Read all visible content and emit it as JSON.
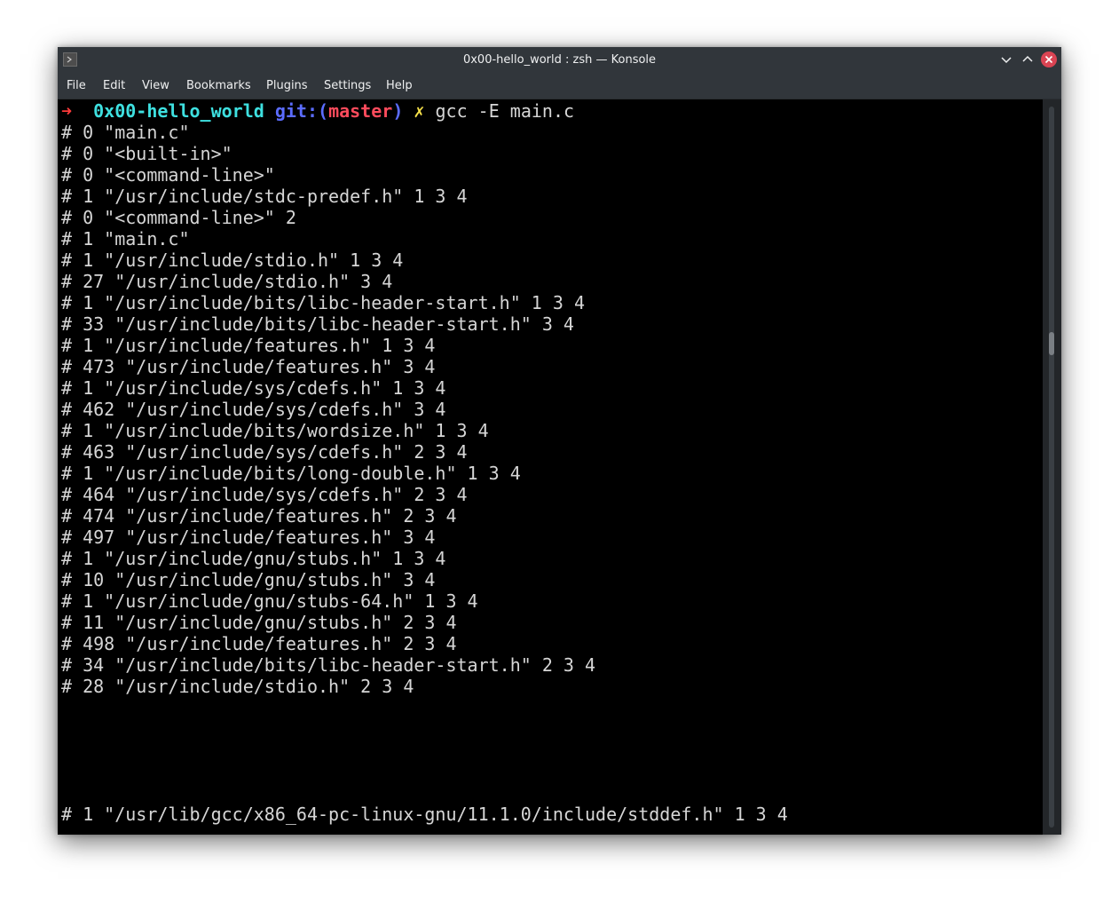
{
  "window": {
    "title": "0x00-hello_world : zsh — Konsole"
  },
  "menubar": {
    "items": [
      {
        "label": "File"
      },
      {
        "label": "Edit"
      },
      {
        "label": "View"
      },
      {
        "label": "Bookmarks"
      },
      {
        "label": "Plugins"
      },
      {
        "label": "Settings"
      },
      {
        "label": "Help"
      }
    ]
  },
  "prompt": {
    "arrow": "➜",
    "directory": "0x00-hello_world",
    "git_label": "git:(",
    "branch": "master",
    "git_close": ")",
    "dirty_mark": "✗",
    "command": "gcc -E main.c"
  },
  "output_lines": [
    "# 0 \"main.c\"",
    "# 0 \"<built-in>\"",
    "# 0 \"<command-line>\"",
    "# 1 \"/usr/include/stdc-predef.h\" 1 3 4",
    "# 0 \"<command-line>\" 2",
    "# 1 \"main.c\"",
    "# 1 \"/usr/include/stdio.h\" 1 3 4",
    "# 27 \"/usr/include/stdio.h\" 3 4",
    "# 1 \"/usr/include/bits/libc-header-start.h\" 1 3 4",
    "# 33 \"/usr/include/bits/libc-header-start.h\" 3 4",
    "# 1 \"/usr/include/features.h\" 1 3 4",
    "# 473 \"/usr/include/features.h\" 3 4",
    "# 1 \"/usr/include/sys/cdefs.h\" 1 3 4",
    "# 462 \"/usr/include/sys/cdefs.h\" 3 4",
    "# 1 \"/usr/include/bits/wordsize.h\" 1 3 4",
    "# 463 \"/usr/include/sys/cdefs.h\" 2 3 4",
    "# 1 \"/usr/include/bits/long-double.h\" 1 3 4",
    "# 464 \"/usr/include/sys/cdefs.h\" 2 3 4",
    "# 474 \"/usr/include/features.h\" 2 3 4",
    "# 497 \"/usr/include/features.h\" 3 4",
    "# 1 \"/usr/include/gnu/stubs.h\" 1 3 4",
    "# 10 \"/usr/include/gnu/stubs.h\" 3 4",
    "# 1 \"/usr/include/gnu/stubs-64.h\" 1 3 4",
    "# 11 \"/usr/include/gnu/stubs.h\" 2 3 4",
    "# 498 \"/usr/include/features.h\" 2 3 4",
    "# 34 \"/usr/include/bits/libc-header-start.h\" 2 3 4",
    "# 28 \"/usr/include/stdio.h\" 2 3 4"
  ],
  "last_line": "# 1 \"/usr/lib/gcc/x86_64-pc-linux-gnu/11.1.0/include/stddef.h\" 1 3 4",
  "colors": {
    "titlebar": "#31363b",
    "terminal_bg": "#000000",
    "close_button": "#da4453",
    "prompt_arrow": "#ff3b3b",
    "prompt_dir": "#3ee0e0",
    "prompt_git": "#5b6cff",
    "prompt_branch": "#ff4b5c",
    "prompt_dirty": "#f5e04a"
  },
  "icons": {
    "app": "konsole-icon",
    "minimize": "chevron-down-icon",
    "maximize": "chevron-up-icon",
    "close": "close-icon"
  }
}
